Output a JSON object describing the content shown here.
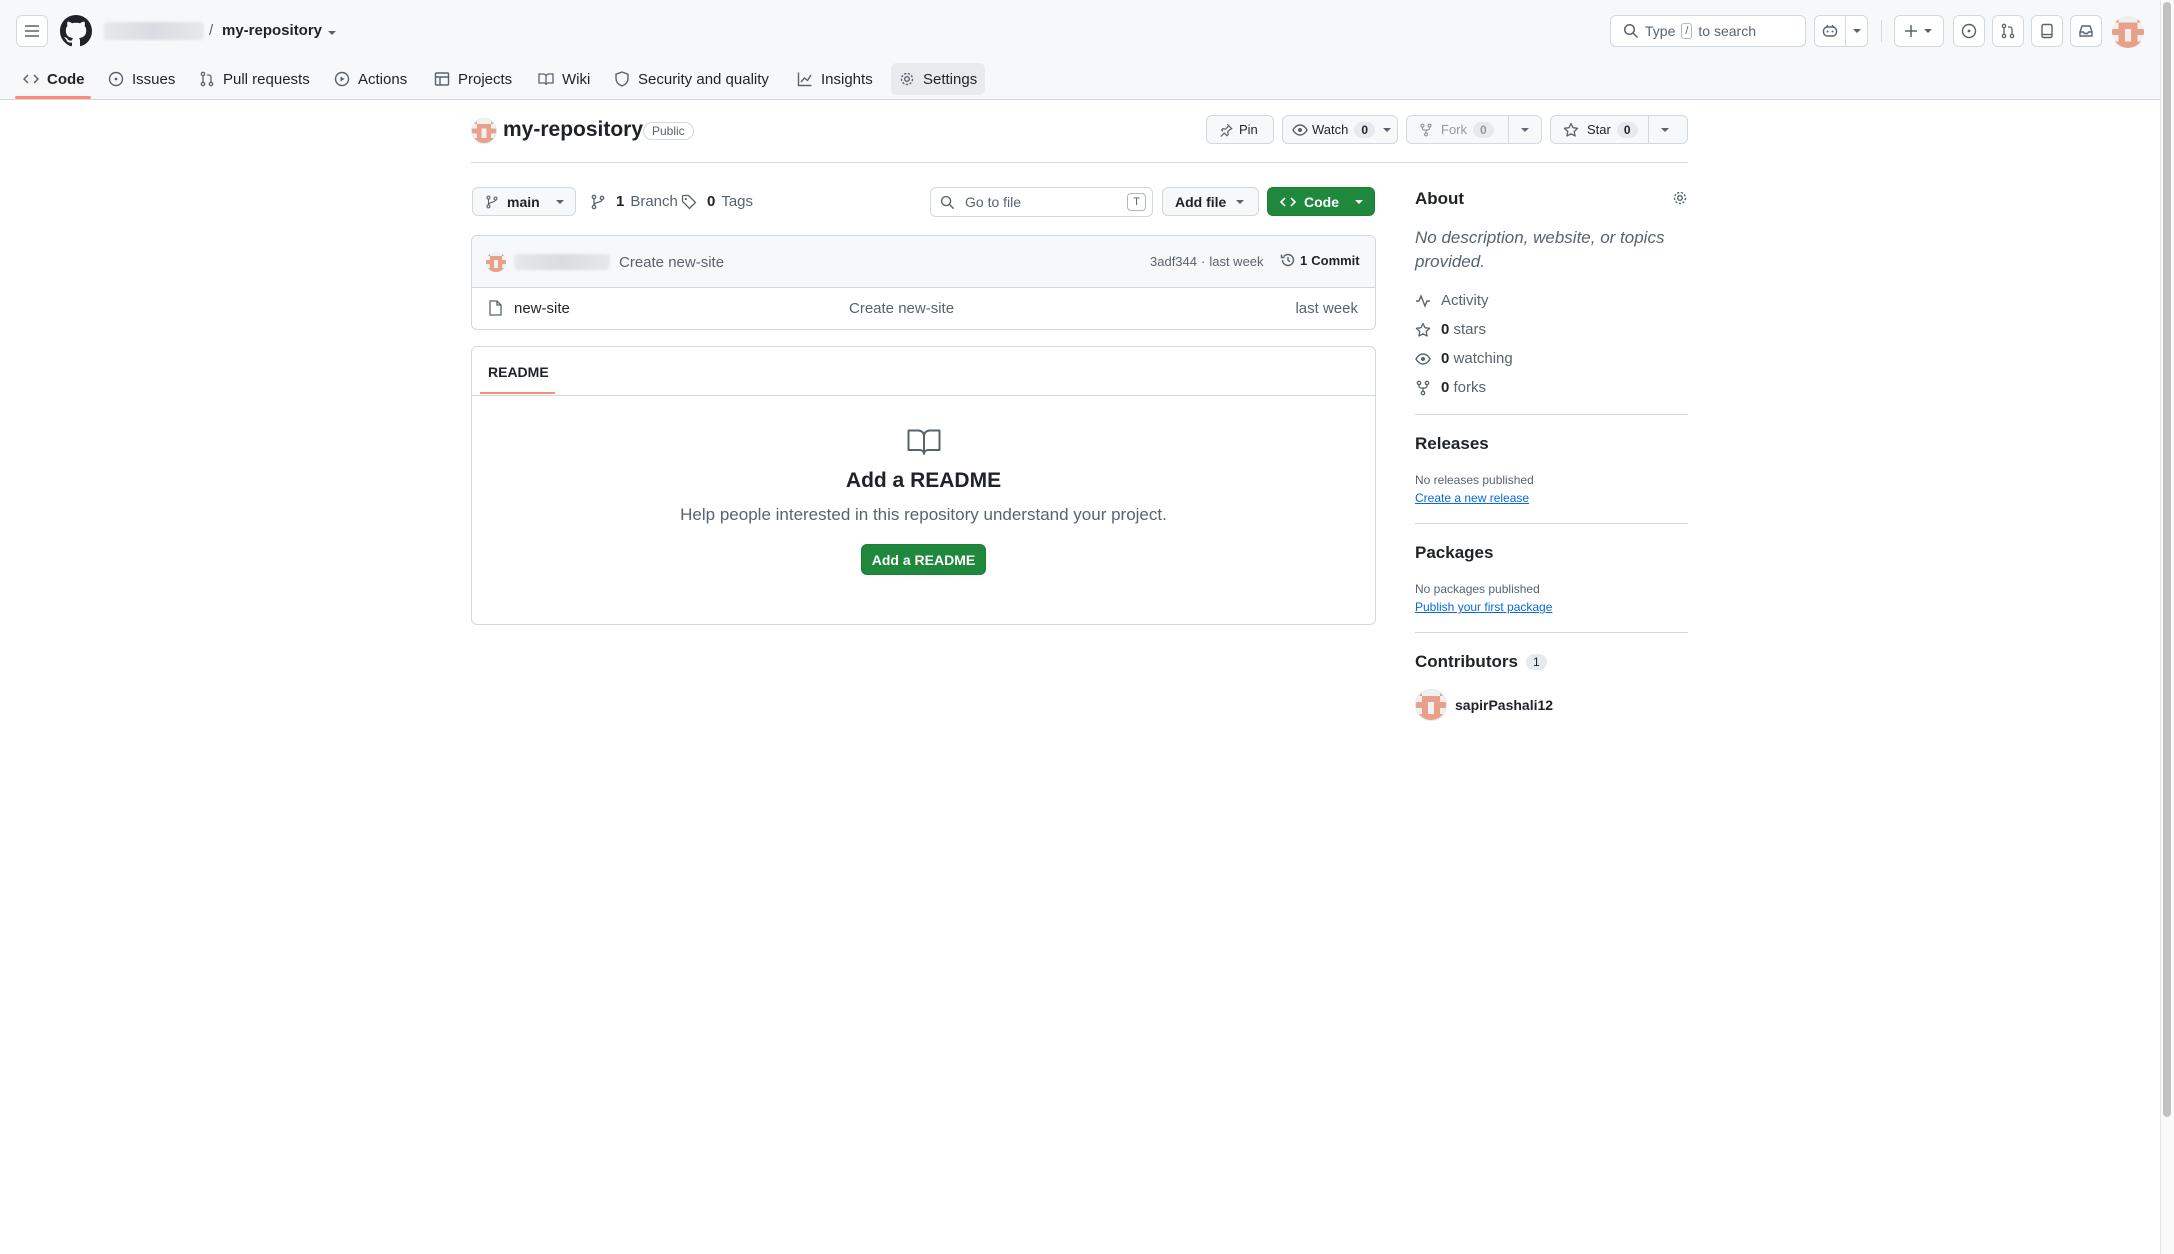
{
  "header": {
    "repo_separator": "/",
    "repo_name": "my-repository",
    "search_type": "Type",
    "search_key": "/",
    "search_rest": "to search"
  },
  "tabs": [
    {
      "label": "Code"
    },
    {
      "label": "Issues"
    },
    {
      "label": "Pull requests"
    },
    {
      "label": "Actions"
    },
    {
      "label": "Projects"
    },
    {
      "label": "Wiki"
    },
    {
      "label": "Security and quality"
    },
    {
      "label": "Insights"
    },
    {
      "label": "Settings"
    }
  ],
  "repo": {
    "name": "my-repository",
    "visibility": "Public",
    "pin_label": "Pin",
    "watch_label": "Watch",
    "watch_count": "0",
    "fork_label": "Fork",
    "fork_count": "0",
    "star_label": "Star",
    "star_count": "0"
  },
  "toolbar": {
    "branch": "main",
    "branches_count": "1",
    "branches_label": "Branch",
    "tags_count": "0",
    "tags_label": "Tags",
    "goto_placeholder": "Go to file",
    "goto_key": "T",
    "add_file": "Add file",
    "code": "Code"
  },
  "commit": {
    "message": "Create new-site",
    "hash": "3adf344",
    "sep": "·",
    "time": "last week",
    "commits_count": "1",
    "commits_label": "Commit"
  },
  "files": [
    {
      "name": "new-site",
      "message": "Create new-site",
      "time": "last week"
    }
  ],
  "readme": {
    "tab": "README",
    "title": "Add a README",
    "text": "Help people interested in this repository understand your project.",
    "button": "Add a README"
  },
  "about": {
    "heading": "About",
    "description": "No description, website, or topics provided.",
    "activity": "Activity",
    "stars_count": "0",
    "stars_label": "stars",
    "watching_count": "0",
    "watching_label": "watching",
    "forks_count": "0",
    "forks_label": "forks"
  },
  "releases": {
    "heading": "Releases",
    "text": "No releases published",
    "link": "Create a new release"
  },
  "packages": {
    "heading": "Packages",
    "text": "No packages published",
    "link": "Publish your first package"
  },
  "contributors": {
    "heading": "Contributors",
    "count": "1",
    "user": "sapirPashali12"
  },
  "colors": {
    "accent_green": "#1f883d",
    "link_blue": "#0969da",
    "tab_underline": "#fd8c73"
  }
}
